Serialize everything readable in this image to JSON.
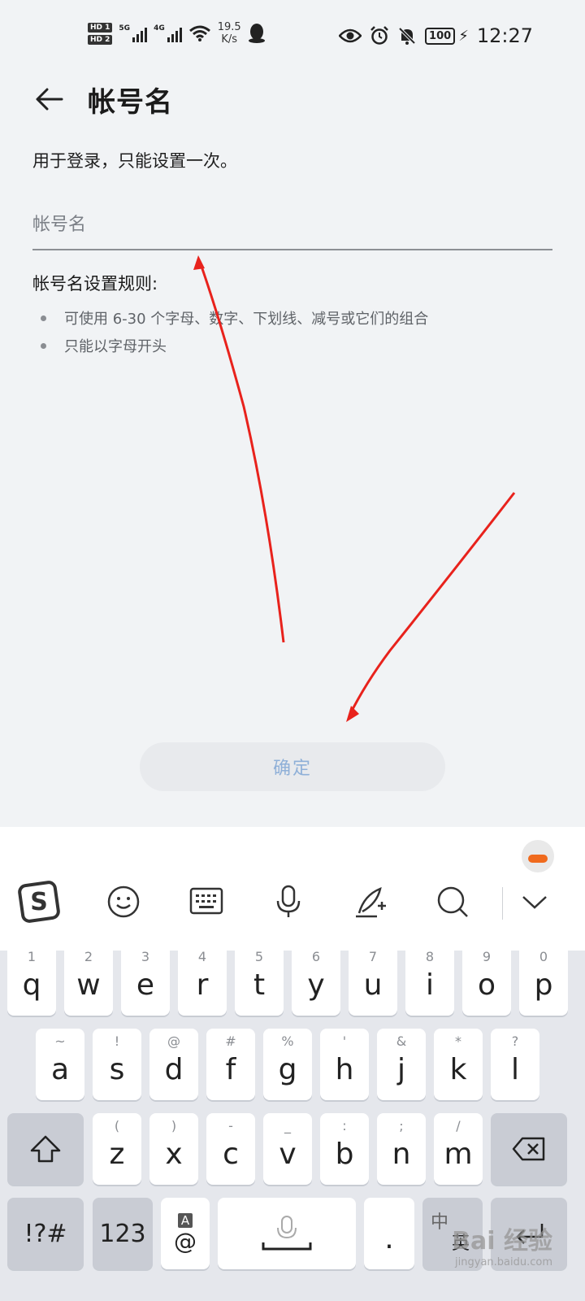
{
  "status_bar": {
    "sim1": "HD 1",
    "sim2": "HD 2",
    "net1": "5G",
    "net2": "4G",
    "speed_value": "19.5",
    "speed_unit": "K/s",
    "battery": "100",
    "time": "12:27"
  },
  "header": {
    "title": "帐号名"
  },
  "form": {
    "hint": "用于登录，只能设置一次。",
    "username_placeholder": "帐号名",
    "rules_title": "帐号名设置规则:",
    "rules": [
      "可使用 6-30 个字母、数字、下划线、减号或它们的组合",
      "只能以字母开头"
    ],
    "confirm_label": "确定"
  },
  "keyboard": {
    "row1": [
      {
        "sub": "1",
        "key": "q"
      },
      {
        "sub": "2",
        "key": "w"
      },
      {
        "sub": "3",
        "key": "e"
      },
      {
        "sub": "4",
        "key": "r"
      },
      {
        "sub": "5",
        "key": "t"
      },
      {
        "sub": "6",
        "key": "y"
      },
      {
        "sub": "7",
        "key": "u"
      },
      {
        "sub": "8",
        "key": "i"
      },
      {
        "sub": "9",
        "key": "o"
      },
      {
        "sub": "0",
        "key": "p"
      }
    ],
    "row2": [
      {
        "sub": "~",
        "key": "a"
      },
      {
        "sub": "!",
        "key": "s"
      },
      {
        "sub": "@",
        "key": "d"
      },
      {
        "sub": "#",
        "key": "f"
      },
      {
        "sub": "%",
        "key": "g"
      },
      {
        "sub": "'",
        "key": "h"
      },
      {
        "sub": "&",
        "key": "j"
      },
      {
        "sub": "*",
        "key": "k"
      },
      {
        "sub": "?",
        "key": "l"
      }
    ],
    "row3": [
      {
        "sub": "(",
        "key": "z"
      },
      {
        "sub": ")",
        "key": "x"
      },
      {
        "sub": "-",
        "key": "c"
      },
      {
        "sub": "_",
        "key": "v"
      },
      {
        "sub": ":",
        "key": "b"
      },
      {
        "sub": ";",
        "key": "n"
      },
      {
        "sub": "/",
        "key": "m"
      }
    ],
    "symbols_label": "!?#",
    "numbers_label": "123",
    "at_key_top": "A",
    "at_key_label": "@",
    "period_label": ".",
    "lang_label_top": "中",
    "lang_label_bottom": "英"
  },
  "watermark": {
    "logo": "Bai 经验",
    "url": "jingyan.baidu.com"
  },
  "colors": {
    "background": "#f1f3f5",
    "confirm_text": "#8fb0d8",
    "annotation_arrow": "#e8221c"
  }
}
